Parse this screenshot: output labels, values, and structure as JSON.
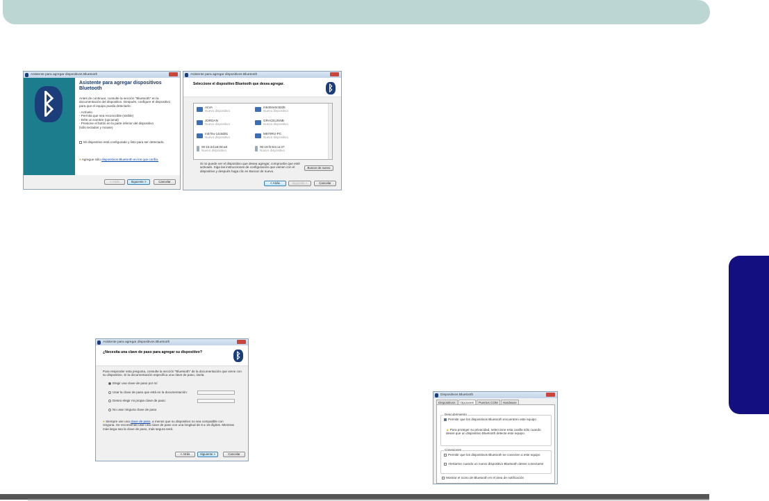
{
  "wizard_title": "Asistente para agregar dispositivos Bluetooth",
  "dialog1": {
    "heading": "Asistente para agregar dispositivos Bluetooth",
    "intro": "Antes de continuar, consulte la sección \"Bluetooth\" en la documentación del dispositivo. Después, configure el dispositivo para que el equipo pueda detectarlo:",
    "steps": [
      "- Actívelo",
      "- Permita que sea reconocible (visible)",
      "- Déle un nombre (opcional)",
      "- Presione el botón en la parte inferior del dispositivo",
      "  (sólo teclados y mouse)"
    ],
    "checkbox": "Mi dispositivo está configurado y listo para ser detectado.",
    "note_prefix": "Agregue sólo",
    "note_link": "dispositivos Bluetooth en los que confía.",
    "back": "< Atrás",
    "next": "Siguiente >",
    "cancel": "Cancelar"
  },
  "dialog2": {
    "heading": "Seleccione el dispositivo Bluetooth que desea agregar.",
    "devices": [
      {
        "name": "ALVA",
        "status": "Nuevo dispositivo",
        "type": "pc"
      },
      {
        "name": "m540ire0c82d5",
        "status": "Nuevo dispositivo",
        "type": "pc"
      },
      {
        "name": "JORDAN",
        "status": "Nuevo dispositivo",
        "type": "pc"
      },
      {
        "name": "GRACELINNB",
        "status": "Nuevo dispositivo",
        "type": "pc"
      },
      {
        "name": "m570u-14c8d91",
        "status": "Nuevo dispositivo",
        "type": "pc"
      },
      {
        "name": "M570RU-PC",
        "status": "Nuevo dispositivo",
        "type": "pc"
      },
      {
        "name": "00:15:2d:a6:08:a8",
        "status": "Nuevo dispositivo",
        "type": "phone"
      },
      {
        "name": "00:19:f3:54:ca:37",
        "status": "Nuevo dispositivo",
        "type": "phone"
      }
    ],
    "help": "Si no puede ver el dispositivo que desea agregar, compruebe que esté activado. Siga las instrucciones de configuración que vienen con el dispositivo y después haga clic en Buscar de nuevo.",
    "search_again": "Buscar de nuevo",
    "back": "< Atrás",
    "next": "Siguiente >",
    "cancel": "Cancelar"
  },
  "dialog3": {
    "heading": "¿Necesita una clave de paso para agregar su dispositivo?",
    "intro": "Para responder esta pregunta, consulte la sección \"Bluetooth\" de la documentación que viene con su dispositivo. Si la documentación especifica una clave de paso, úsela.",
    "options": [
      "Elegir una clave de paso por mí",
      "Usar la clave de paso que está en la documentación:",
      "Deseo elegir mi propia clave de paso:",
      "No usar ninguna clave de paso"
    ],
    "note_prefix": "Siempre use una",
    "note_link": "clave de paso",
    "note_rest": ", a menos que su dispositivo no sea compatible con ninguna. Se recomienda usar una clave de paso con una longitud de 8 a 16 dígitos. Mientras más larga sea la clave de paso, más segura será.",
    "back": "< Atrás",
    "next": "Siguiente >",
    "cancel": "Cancelar"
  },
  "dialog4": {
    "title": "Dispositivos Bluetooth",
    "tabs": [
      "Dispositivos",
      "Opciones",
      "Puertos COM",
      "Hardware"
    ],
    "discovery_label": "Descubrimiento",
    "discovery_check": "Permitir que los dispositivos Bluetooth encuentren este equipo",
    "warning": "Para proteger su privacidad, seleccione esta casilla sólo cuando desee que un dispositivo Bluetooth detecte este equipo.",
    "connections_label": "Conexiones",
    "conn_check1": "Permitir que los dispositivos Bluetooth se conecten a este equipo",
    "conn_check2": "Alertarme cuando un nuevo dispositivo Bluetooth desee conectarse",
    "tray_check": "Mostrar el icono de Bluetooth en el área de notificación"
  }
}
